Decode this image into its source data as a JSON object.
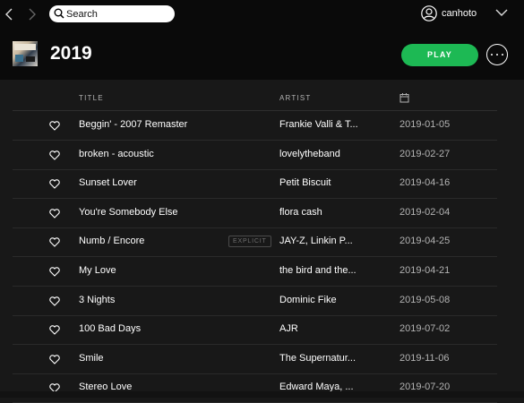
{
  "search": {
    "placeholder": "Search"
  },
  "user": {
    "name": "canhoto"
  },
  "playlist": {
    "title": "2019",
    "play_label": "PLAY"
  },
  "columns": {
    "title": "TITLE",
    "artist": "ARTIST",
    "date_icon": "calendar-icon"
  },
  "tracks": [
    {
      "title": "Beggin' - 2007 Remaster",
      "artist": "Frankie Valli & T...",
      "date": "2019-01-05"
    },
    {
      "title": "broken - acoustic",
      "artist": "lovelytheband",
      "date": "2019-02-27"
    },
    {
      "title": "Sunset Lover",
      "artist": "Petit Biscuit",
      "date": "2019-04-16"
    },
    {
      "title": "You're Somebody Else",
      "artist": "flora cash",
      "date": "2019-02-04"
    },
    {
      "title": "Numb / Encore",
      "explicit": "EXPLICIT",
      "artist": "JAY-Z, Linkin P...",
      "date": "2019-04-25"
    },
    {
      "title": "My Love",
      "artist": "the bird and the...",
      "date": "2019-04-21"
    },
    {
      "title": "3 Nights",
      "artist": "Dominic Fike",
      "date": "2019-05-08"
    },
    {
      "title": "100 Bad Days",
      "artist": "AJR",
      "date": "2019-07-02"
    },
    {
      "title": "Smile",
      "artist": "The Supernatur...",
      "date": "2019-11-06"
    },
    {
      "title": "Stereo Love",
      "artist": "Edward Maya, ...",
      "date": "2019-07-20"
    }
  ],
  "colors": {
    "accent": "#1db954",
    "background": "#181818",
    "topbar": "#0a0a0a"
  }
}
